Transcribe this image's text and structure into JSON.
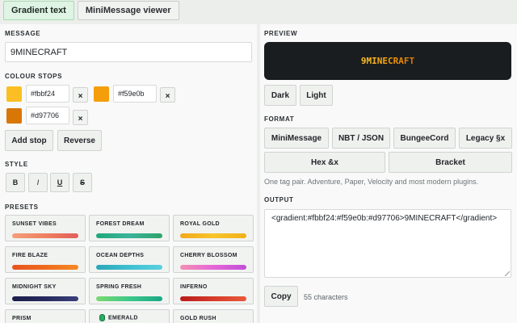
{
  "tabs": [
    {
      "label": "Gradient text",
      "active": true
    },
    {
      "label": "MiniMessage viewer",
      "active": false
    }
  ],
  "left": {
    "message_label": "MESSAGE",
    "message_value": "9MINECRAFT",
    "colour_stops_label": "COLOUR STOPS",
    "stops": [
      {
        "hex": "#fbbf24",
        "color": "#fbbf24",
        "remove": "×"
      },
      {
        "hex": "#f59e0b",
        "color": "#f59e0b",
        "remove": "×"
      },
      {
        "hex": "#d97706",
        "color": "#d97706",
        "remove": "×"
      }
    ],
    "add_stop": "Add stop",
    "reverse": "Reverse",
    "style_label": "STYLE",
    "styles": [
      "B",
      "I",
      "U",
      "S"
    ],
    "presets_label": "PRESETS",
    "presets": [
      {
        "name": "SUNSET VIBES",
        "colors": [
          "#f59e7b",
          "#ef8060",
          "#e35d5b"
        ]
      },
      {
        "name": "FOREST DREAM",
        "colors": [
          "#1fa87a",
          "#3bb39a",
          "#2fa36b"
        ]
      },
      {
        "name": "ROYAL GOLD",
        "colors": [
          "#f2a81d",
          "#f8c42a",
          "#f2b01b"
        ]
      },
      {
        "name": "FIRE BLAZE",
        "colors": [
          "#e8541e",
          "#ef6b1f",
          "#f48a23"
        ]
      },
      {
        "name": "OCEAN DEPTHS",
        "colors": [
          "#2aa7b8",
          "#3fc0d0",
          "#5ad0e0"
        ]
      },
      {
        "name": "CHERRY BLOSSOM",
        "colors": [
          "#f48fb1",
          "#e667d8",
          "#c04fd8"
        ]
      },
      {
        "name": "MIDNIGHT SKY",
        "colors": [
          "#1b1f4a",
          "#262a5e",
          "#3a3f7a"
        ]
      },
      {
        "name": "SPRING FRESH",
        "colors": [
          "#7bd86f",
          "#3cc88a",
          "#1aa886"
        ]
      },
      {
        "name": "INFERNO",
        "colors": [
          "#b91c1c",
          "#d63a2a",
          "#e85a3a"
        ]
      },
      {
        "name": "PRISM",
        "colors": [
          "#ef4444",
          "#eab308",
          "#3b82f6"
        ]
      },
      {
        "name": "EMERALD",
        "icon": "emerald-icon",
        "colors": [
          "#10b981",
          "#059669",
          "#047857"
        ]
      },
      {
        "name": "GOLD RUSH",
        "colors": [
          "#facc15",
          "#eab308",
          "#ca8a04"
        ]
      }
    ]
  },
  "right": {
    "preview_label": "PREVIEW",
    "preview_text": "9MINECRAFT",
    "preview_colors": [
      "#fbbf24",
      "#f59e0b",
      "#d97706"
    ],
    "theme_dark": "Dark",
    "theme_light": "Light",
    "format_label": "FORMAT",
    "formats": [
      "MiniMessage",
      "NBT / JSON",
      "BungeeCord",
      "Legacy §x",
      "Hex &x",
      "Bracket"
    ],
    "format_hint": "One tag pair. Adventure, Paper, Velocity and most modern plugins.",
    "output_label": "OUTPUT",
    "output_value": "<gradient:#fbbf24:#f59e0b:#d97706>9MINECRAFT</gradient>",
    "copy": "Copy",
    "char_count": "55 characters"
  }
}
